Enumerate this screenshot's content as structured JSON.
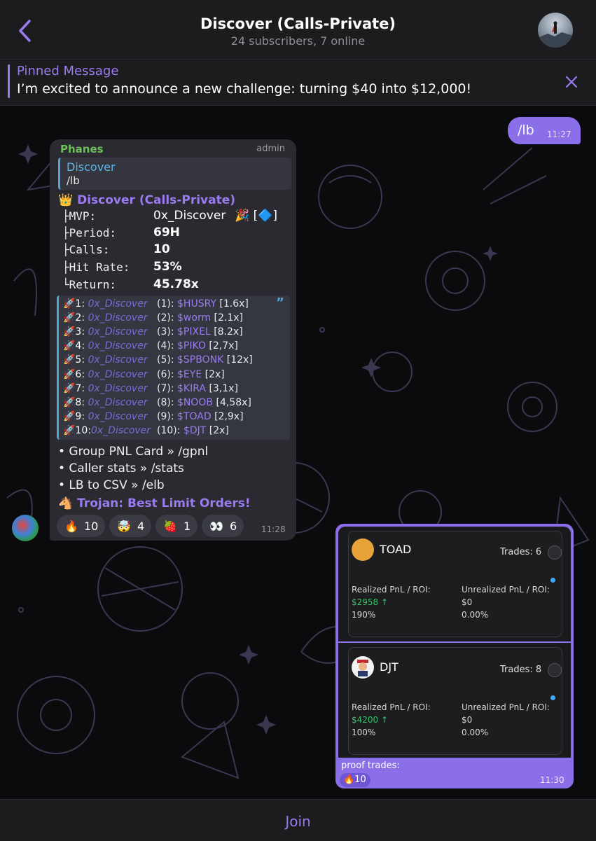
{
  "header": {
    "title": "Discover (Calls-Private)",
    "subtitle": "24 subscribers, 7 online"
  },
  "pinned": {
    "label": "Pinned Message",
    "text": "I’m excited to announce a new challenge: turning $40 into $12,000!"
  },
  "outgoing": {
    "text": "/lb",
    "time": "11:27"
  },
  "incoming": {
    "sender": "Phanes",
    "role": "admin",
    "reply_name": "Discover",
    "reply_text": "/lb",
    "group_title": "👑 Discover (Calls-Private)",
    "stats": [
      {
        "label": "├MVP:",
        "value": "0x_Discover",
        "extra": "🎉 [🔷]"
      },
      {
        "label": "├Period:",
        "value": "69H"
      },
      {
        "label": "├Calls:",
        "value": "10"
      },
      {
        "label": "├Hit Rate:",
        "value": "53%"
      },
      {
        "label": "└Return:",
        "value": "45.78x"
      }
    ],
    "leaderboard": [
      {
        "rank": "🚀1:",
        "name": "0x_Discover",
        "idx": "(1):",
        "ticker": "$HUSRY",
        "mult": "[1.6x]"
      },
      {
        "rank": "🚀2:",
        "name": "0x_Discover",
        "idx": "(2):",
        "ticker": "$worm",
        "mult": "[2.1x]"
      },
      {
        "rank": "🚀3:",
        "name": "0x_Discover",
        "idx": "(3):",
        "ticker": "$PIXEL",
        "mult": "[8.2x]"
      },
      {
        "rank": "🚀4:",
        "name": "0x_Discover",
        "idx": "(4):",
        "ticker": "$PIKO",
        "mult": "[2,7x]"
      },
      {
        "rank": "🚀5:",
        "name": "0x_Discover",
        "idx": "(5):",
        "ticker": "$SPBONK",
        "mult": "[12x]"
      },
      {
        "rank": "🚀6:",
        "name": "0x_Discover",
        "idx": "(6):",
        "ticker": "$EYE",
        "mult": "[2x]"
      },
      {
        "rank": "🚀7:",
        "name": "0x_Discover",
        "idx": "(7):",
        "ticker": "$KIRA",
        "mult": "[3,1x]"
      },
      {
        "rank": "🚀8:",
        "name": "0x_Discover",
        "idx": "(8):",
        "ticker": "$NOOB",
        "mult": "[4,58x]"
      },
      {
        "rank": "🚀9:",
        "name": "0x_Discover",
        "idx": "(9):",
        "ticker": "$TOAD",
        "mult": "[2,9x]"
      },
      {
        "rank": "🚀10:",
        "name": "0x_Discover",
        "idx": "(10):",
        "ticker": "$DJT",
        "mult": "[2x]"
      }
    ],
    "commands": [
      "• Group PNL Card » /gpnl",
      "• Caller stats » /stats",
      "• LB to CSV » /elb"
    ],
    "promo": "🐴 Trojan: Best Limit Orders!",
    "reactions": [
      {
        "emoji": "🔥",
        "count": "10"
      },
      {
        "emoji": "🤯",
        "count": "4"
      },
      {
        "emoji": "🍓",
        "count": "1"
      },
      {
        "emoji": "👀",
        "count": "6"
      }
    ],
    "time": "11:28"
  },
  "pnl_image": {
    "cards": [
      {
        "token": "TOAD",
        "trades": "Trades: 6",
        "realized_label": "Realized PnL / ROI:",
        "realized_value": "$2958 ↑",
        "realized_roi": "190%",
        "unrealized_label": "Unrealized PnL / ROI:",
        "unrealized_value": "$0",
        "unrealized_roi": "0.00%"
      },
      {
        "token": "DJT",
        "trades": "Trades: 8",
        "realized_label": "Realized PnL / ROI:",
        "realized_value": "$4200 ↑",
        "realized_roi": "100%",
        "unrealized_label": "Unrealized PnL / ROI:",
        "unrealized_value": "$0",
        "unrealized_roi": "0.00%"
      }
    ],
    "caption": "proof trades:",
    "reaction": "🔥10",
    "time": "11:30"
  },
  "footer": {
    "join_label": "Join"
  },
  "colors": {
    "accent": "#9a7cf0",
    "bubble_in": "#2a2a30",
    "bubble_out": "#8a6fe8",
    "green": "#35c46b",
    "link_blue": "#4fa7d8"
  }
}
